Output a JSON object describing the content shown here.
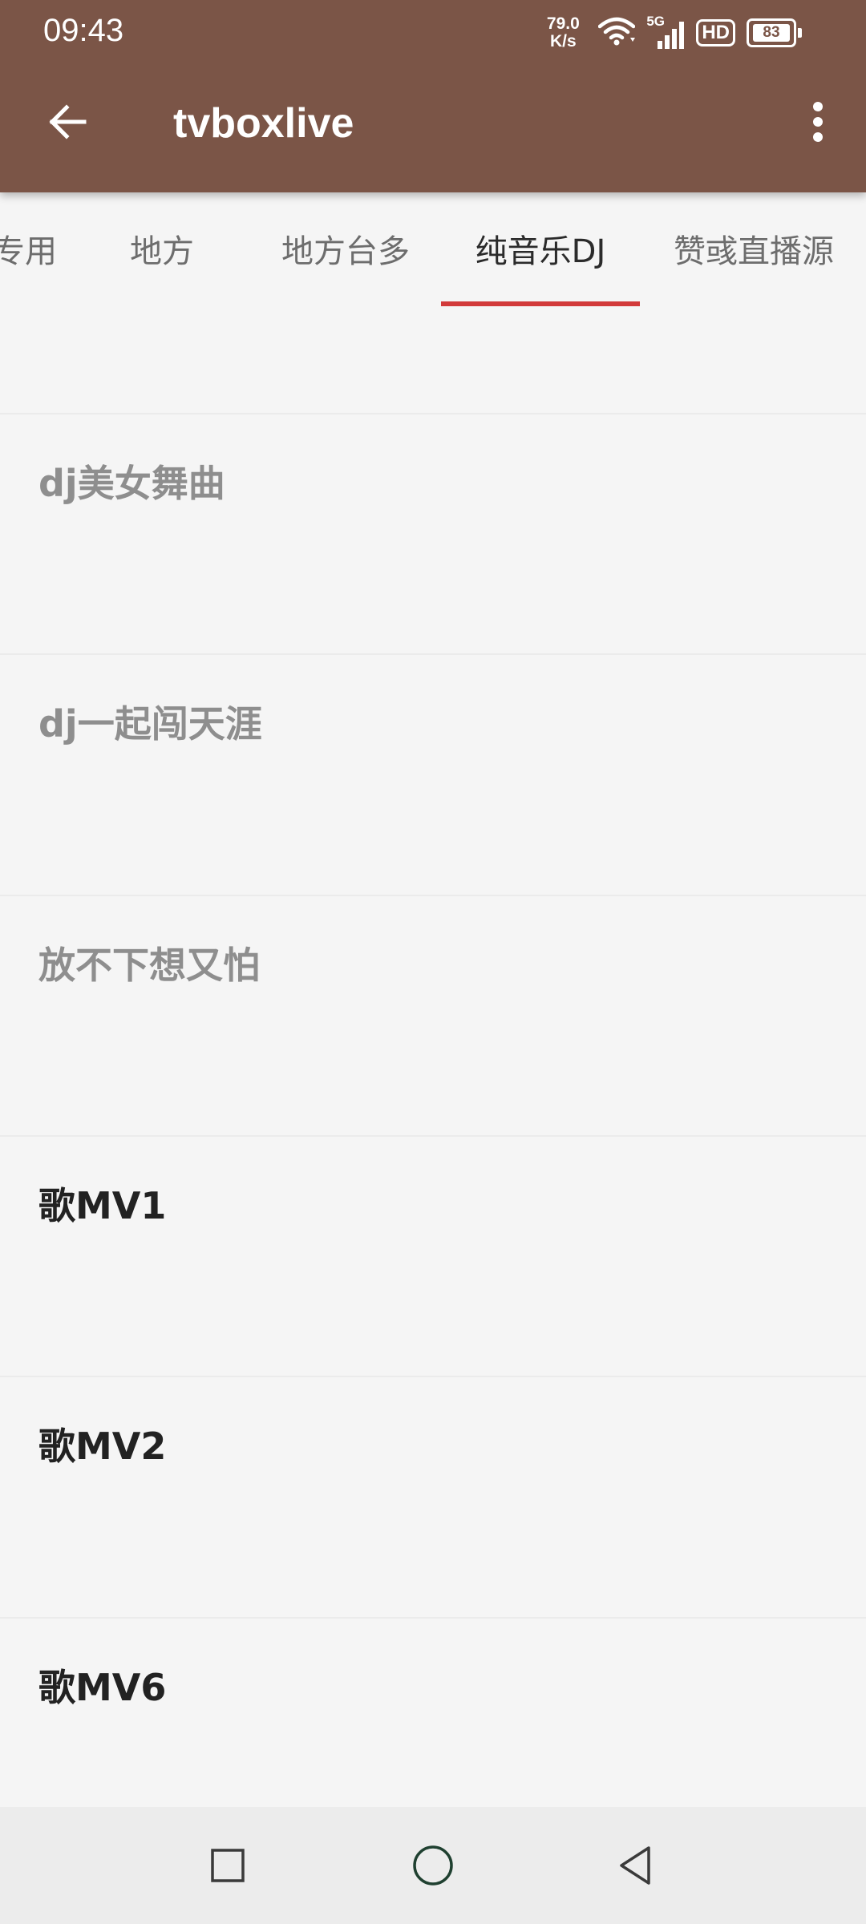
{
  "status_bar": {
    "time": "09:43",
    "net_speed_value": "79.0",
    "net_speed_unit": "K/s",
    "network_type": "5G",
    "hd_label": "HD",
    "battery_level": "83"
  },
  "app_bar": {
    "title": "tvboxlive",
    "background_color": "#7b5547"
  },
  "tabs": [
    {
      "label": "专用",
      "active": false
    },
    {
      "label": "地方",
      "active": false
    },
    {
      "label": "地方台多",
      "active": false
    },
    {
      "label": "纯音乐DJ",
      "active": true
    },
    {
      "label": "赞彧直播源",
      "active": false
    }
  ],
  "accent_color": "#d23a3a",
  "channels": [
    {
      "label": "",
      "dim": true
    },
    {
      "label": "dj美女舞曲",
      "dim": true
    },
    {
      "label": "dj一起闯天涯",
      "dim": true
    },
    {
      "label": "放不下想又怕",
      "dim": true
    },
    {
      "label": "歌MV1",
      "dim": false
    },
    {
      "label": "歌MV2",
      "dim": false
    },
    {
      "label": "歌MV6",
      "dim": false
    }
  ],
  "icons": {
    "back": "arrow-left-icon",
    "menu": "more-vertical-icon",
    "wifi": "wifi-icon",
    "signal": "signal-icon",
    "recents": "square-icon",
    "home": "circle-icon",
    "nav_back": "triangle-left-icon"
  }
}
